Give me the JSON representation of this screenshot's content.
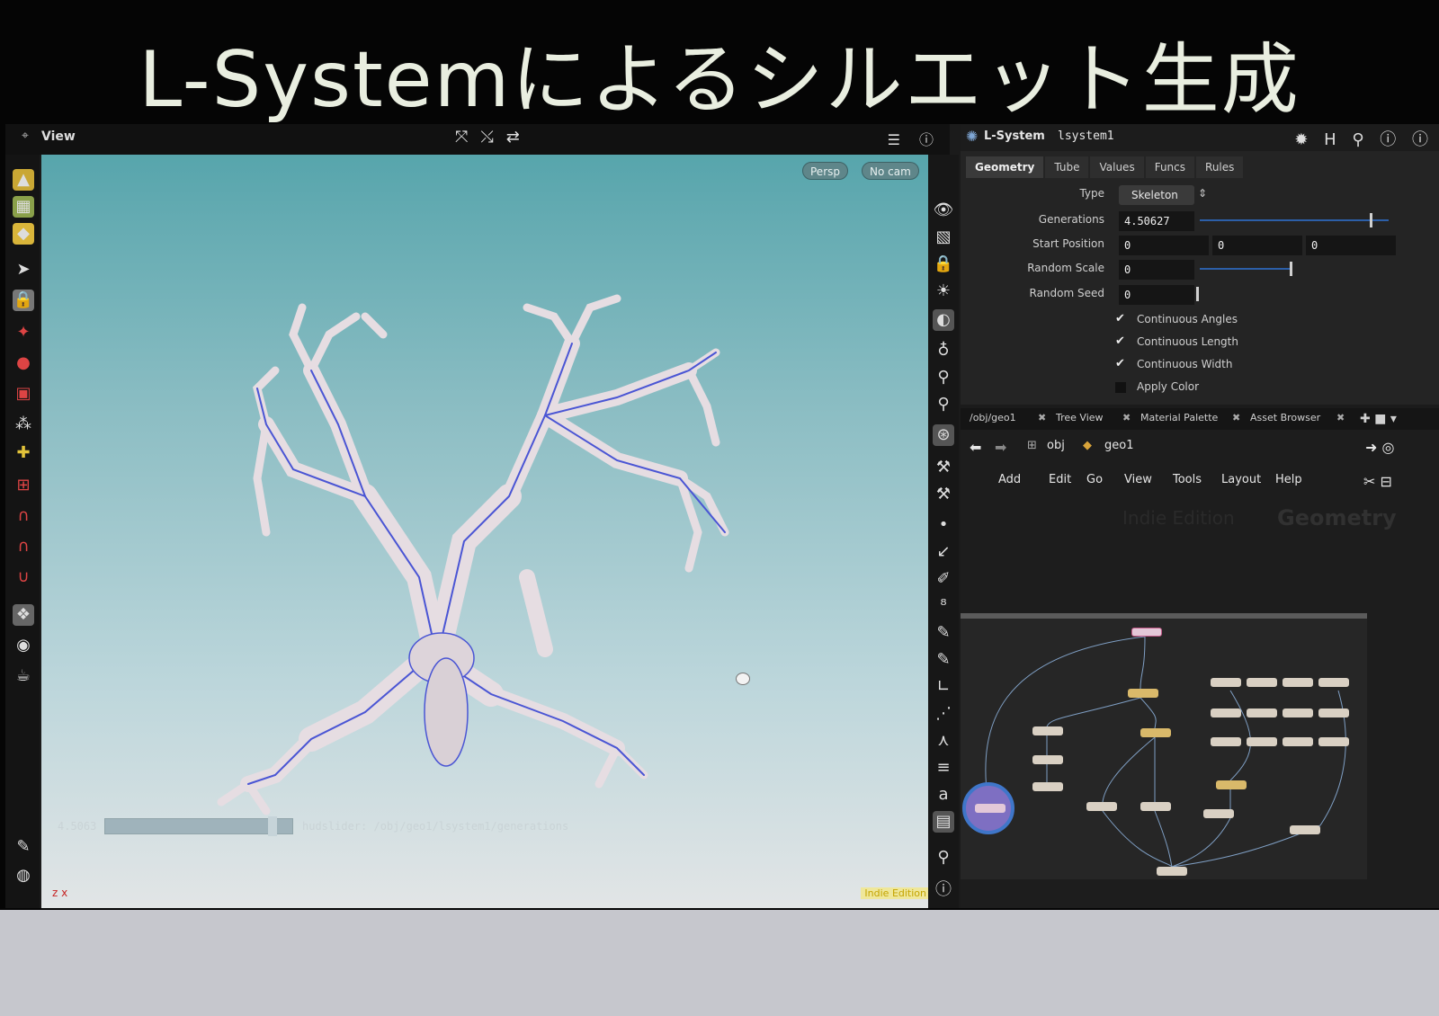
{
  "slide": {
    "title": "L-Systemによるシルエット生成"
  },
  "viewport": {
    "pane_label": "View",
    "camera_persp": "Persp",
    "camera_nocam": "No cam",
    "slider_value": "4.5063",
    "slider_path": "hudslider: /obj/geo1/lsystem1/generations",
    "badge": "Indie Edition",
    "axis_label": "z x"
  },
  "params": {
    "node_type": "L-System",
    "node_name": "lsystem1",
    "tabs": [
      "Geometry",
      "Tube",
      "Values",
      "Funcs",
      "Rules"
    ],
    "type_label": "Type",
    "type_value": "Skeleton",
    "generations_label": "Generations",
    "generations_value": "4.50627",
    "generations_fraction": 0.9,
    "start_position_label": "Start Position",
    "start_position": [
      "0",
      "0",
      "0"
    ],
    "random_scale_label": "Random Scale",
    "random_scale_value": "0",
    "random_seed_label": "Random Seed",
    "random_seed_value": "0",
    "toggles": [
      {
        "label": "Continuous Angles",
        "checked": true
      },
      {
        "label": "Continuous Length",
        "checked": true
      },
      {
        "label": "Continuous Width",
        "checked": true
      },
      {
        "label": "Apply Color",
        "checked": false
      }
    ]
  },
  "network": {
    "tabs": [
      "/obj/geo1",
      "Tree View",
      "Material Palette",
      "Asset Browser"
    ],
    "path_obj": "obj",
    "path_geo": "geo1",
    "menu": [
      "Add",
      "Edit",
      "Go",
      "View",
      "Tools",
      "Layout",
      "Help"
    ],
    "watermark_left": "Indie Edition",
    "watermark_right": "Geometry"
  },
  "colors": {
    "viewport_top": "#57a5ac",
    "viewport_bottom": "#e2e5e6",
    "mesh_fill": "#e6dde2",
    "mesh_edges": "#4a55d4"
  }
}
